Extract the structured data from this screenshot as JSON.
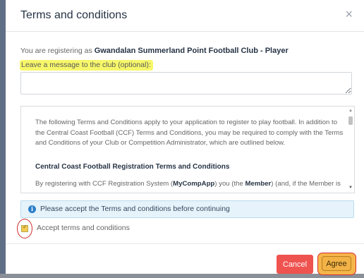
{
  "modal": {
    "title": "Terms and conditions",
    "close_glyph": "×"
  },
  "intro": {
    "prefix": "You are registering as",
    "club_player": "Gwandalan Summerland Point Football Club - Player"
  },
  "message": {
    "label": "Leave a message to the club (optional):",
    "value": ""
  },
  "terms": {
    "paragraph1": "The following Terms and Conditions apply to your application to register to play football. In addition to the Central Coast Football (CCF) Terms and Conditions, you may be required to comply with the Terms and Conditions of your Club or Competition Administrator, which are outlined below.",
    "heading": "Central Coast Football Registration Terms and Conditions",
    "reg_prefix": "By registering with CCF Registration System (",
    "reg_app": "MyCompApp",
    "reg_mid": ") you (the ",
    "reg_member": "Member",
    "reg_suffix": ") (and, if the Member is"
  },
  "alert": {
    "icon": "info-icon",
    "text": "Please accept the Terms and conditions before continuing"
  },
  "accept": {
    "label": "Accept terms and conditions",
    "checked": true
  },
  "footer": {
    "cancel_label": "Cancel",
    "agree_label": "Agree"
  },
  "colors": {
    "title": "#263445",
    "highlight": "#f7f76a",
    "alert_bg": "#e6f3fb",
    "cancel": "#ef5350",
    "agree": "#f2b246",
    "annotation": "#d32f2f"
  }
}
